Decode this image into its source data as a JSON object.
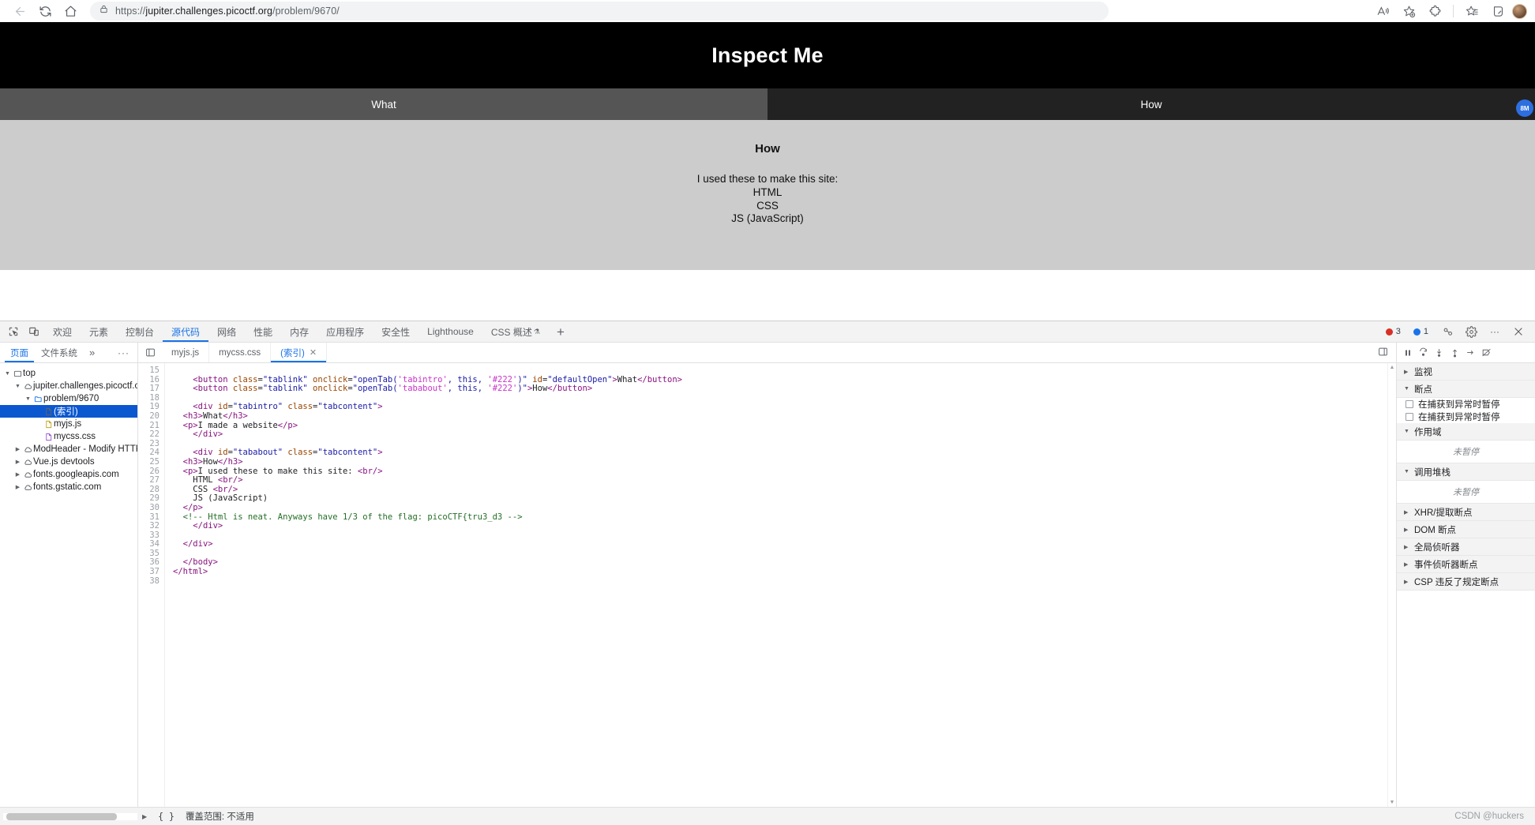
{
  "browser": {
    "url_scheme": "https://",
    "url_main": "jupiter.challenges.picoctf.org",
    "url_path": "/problem/9670/",
    "back_icon": "back-arrow-icon",
    "reload_icon": "reload-icon",
    "home_icon": "home-icon",
    "lock_icon": "lock-icon",
    "read_aloud_icon": "read-aloud-icon",
    "add_favorite_icon": "add-favorite-icon",
    "extensions_icon": "extensions-icon",
    "favorites_icon": "favorites-icon",
    "collections_icon": "collections-icon",
    "profile_icon": "profile-avatar"
  },
  "webpage": {
    "title": "Inspect Me",
    "tabs": [
      {
        "label": "What",
        "active": false
      },
      {
        "label": "How",
        "active": true
      }
    ],
    "content_heading": "How",
    "content_lines": [
      "I used these to make this site:",
      "HTML",
      "CSS",
      "JS (JavaScript)"
    ],
    "float_badge": "8M"
  },
  "devtools": {
    "inspect_icon": "inspect-element-icon",
    "device_icon": "device-toolbar-icon",
    "tabs": [
      {
        "label": "欢迎",
        "active": false
      },
      {
        "label": "元素",
        "active": false
      },
      {
        "label": "控制台",
        "active": false
      },
      {
        "label": "源代码",
        "active": true
      },
      {
        "label": "网络",
        "active": false
      },
      {
        "label": "性能",
        "active": false
      },
      {
        "label": "内存",
        "active": false
      },
      {
        "label": "应用程序",
        "active": false
      },
      {
        "label": "安全性",
        "active": false
      },
      {
        "label": "Lighthouse",
        "active": false
      },
      {
        "label": "CSS 概述",
        "active": false,
        "beta": "⚗"
      }
    ],
    "add_tab_label": "+",
    "error_count": "3",
    "info_count": "1",
    "cast_icon": "cast-icon",
    "settings_icon": "gear-icon",
    "more_icon": "more-options-icon",
    "close_icon": "close-icon",
    "error_color": "#d93025",
    "info_color": "#1a73e8",
    "accent_color": "#1a73e8"
  },
  "navigator": {
    "tabs": [
      {
        "label": "页面",
        "active": true
      },
      {
        "label": "文件系统",
        "active": false
      }
    ],
    "more_label": "»",
    "dots_label": "···",
    "tree": [
      {
        "label": "top",
        "depth": 0,
        "twisty": "▼",
        "icon": "frame-icon",
        "selected": false
      },
      {
        "label": "jupiter.challenges.picoctf.org",
        "depth": 1,
        "twisty": "▼",
        "icon": "cloud-icon",
        "selected": false
      },
      {
        "label": "problem/9670",
        "depth": 2,
        "twisty": "▼",
        "icon": "folder-icon",
        "selected": false
      },
      {
        "label": "(索引)",
        "depth": 3,
        "twisty": "",
        "icon": "document-icon",
        "selected": true
      },
      {
        "label": "myjs.js",
        "depth": 3,
        "twisty": "",
        "icon": "js-file-icon",
        "selected": false
      },
      {
        "label": "mycss.css",
        "depth": 3,
        "twisty": "",
        "icon": "css-file-icon",
        "selected": false
      },
      {
        "label": "ModHeader - Modify HTTP head",
        "depth": 1,
        "twisty": "▶",
        "icon": "cloud-icon",
        "selected": false
      },
      {
        "label": "Vue.js devtools",
        "depth": 1,
        "twisty": "▶",
        "icon": "cloud-icon",
        "selected": false
      },
      {
        "label": "fonts.googleapis.com",
        "depth": 1,
        "twisty": "▶",
        "icon": "cloud-icon",
        "selected": false
      },
      {
        "label": "fonts.gstatic.com",
        "depth": 1,
        "twisty": "▶",
        "icon": "cloud-icon",
        "selected": false
      }
    ]
  },
  "editor": {
    "panel_toggle_icon": "show-navigator-icon",
    "more_icon": "show-debugger-icon",
    "tabs": [
      {
        "label": "myjs.js",
        "active": false,
        "closable": false
      },
      {
        "label": "mycss.css",
        "active": false,
        "closable": false
      },
      {
        "label": "(索引)",
        "active": true,
        "closable": true
      }
    ],
    "close_glyph": "✕",
    "first_line_number": 15,
    "last_line_number": 38,
    "lines": [
      {
        "n": 15,
        "tokens": []
      },
      {
        "n": 16,
        "tokens": [
          {
            "t": "    ",
            "c": "tk-txt"
          },
          {
            "t": "<button",
            "c": "tk-tag"
          },
          {
            "t": " class",
            "c": "tk-attr"
          },
          {
            "t": "=",
            "c": "tk-txt"
          },
          {
            "t": "\"tablink\"",
            "c": "tk-val"
          },
          {
            "t": " onclick",
            "c": "tk-attr"
          },
          {
            "t": "=",
            "c": "tk-txt"
          },
          {
            "t": "\"openTab(",
            "c": "tk-val"
          },
          {
            "t": "'tabintro'",
            "c": "tk-kw"
          },
          {
            "t": ", ",
            "c": "tk-val"
          },
          {
            "t": "this",
            "c": "tk-fn"
          },
          {
            "t": ", ",
            "c": "tk-val"
          },
          {
            "t": "'#222'",
            "c": "tk-kw"
          },
          {
            "t": ")\"",
            "c": "tk-val"
          },
          {
            "t": " id",
            "c": "tk-attr"
          },
          {
            "t": "=",
            "c": "tk-txt"
          },
          {
            "t": "\"defaultOpen\"",
            "c": "tk-val"
          },
          {
            "t": ">",
            "c": "tk-tag"
          },
          {
            "t": "What",
            "c": "tk-txt"
          },
          {
            "t": "</button>",
            "c": "tk-tag"
          }
        ]
      },
      {
        "n": 17,
        "tokens": [
          {
            "t": "    ",
            "c": "tk-txt"
          },
          {
            "t": "<button",
            "c": "tk-tag"
          },
          {
            "t": " class",
            "c": "tk-attr"
          },
          {
            "t": "=",
            "c": "tk-txt"
          },
          {
            "t": "\"tablink\"",
            "c": "tk-val"
          },
          {
            "t": " onclick",
            "c": "tk-attr"
          },
          {
            "t": "=",
            "c": "tk-txt"
          },
          {
            "t": "\"openTab(",
            "c": "tk-val"
          },
          {
            "t": "'tababout'",
            "c": "tk-kw"
          },
          {
            "t": ", ",
            "c": "tk-val"
          },
          {
            "t": "this",
            "c": "tk-fn"
          },
          {
            "t": ", ",
            "c": "tk-val"
          },
          {
            "t": "'#222'",
            "c": "tk-kw"
          },
          {
            "t": ")\"",
            "c": "tk-val"
          },
          {
            "t": ">",
            "c": "tk-tag"
          },
          {
            "t": "How",
            "c": "tk-txt"
          },
          {
            "t": "</button>",
            "c": "tk-tag"
          }
        ]
      },
      {
        "n": 18,
        "tokens": []
      },
      {
        "n": 19,
        "tokens": [
          {
            "t": "    ",
            "c": "tk-txt"
          },
          {
            "t": "<div",
            "c": "tk-tag"
          },
          {
            "t": " id",
            "c": "tk-attr"
          },
          {
            "t": "=",
            "c": "tk-txt"
          },
          {
            "t": "\"tabintro\"",
            "c": "tk-val"
          },
          {
            "t": " class",
            "c": "tk-attr"
          },
          {
            "t": "=",
            "c": "tk-txt"
          },
          {
            "t": "\"tabcontent\"",
            "c": "tk-val"
          },
          {
            "t": ">",
            "c": "tk-tag"
          }
        ]
      },
      {
        "n": 20,
        "tokens": [
          {
            "t": "  ",
            "c": "tk-txt"
          },
          {
            "t": "<h3>",
            "c": "tk-tag"
          },
          {
            "t": "What",
            "c": "tk-txt"
          },
          {
            "t": "</h3>",
            "c": "tk-tag"
          }
        ]
      },
      {
        "n": 21,
        "tokens": [
          {
            "t": "  ",
            "c": "tk-txt"
          },
          {
            "t": "<p>",
            "c": "tk-tag"
          },
          {
            "t": "I made a website",
            "c": "tk-txt"
          },
          {
            "t": "</p>",
            "c": "tk-tag"
          }
        ]
      },
      {
        "n": 22,
        "tokens": [
          {
            "t": "    ",
            "c": "tk-txt"
          },
          {
            "t": "</div>",
            "c": "tk-tag"
          }
        ]
      },
      {
        "n": 23,
        "tokens": []
      },
      {
        "n": 24,
        "tokens": [
          {
            "t": "    ",
            "c": "tk-txt"
          },
          {
            "t": "<div",
            "c": "tk-tag"
          },
          {
            "t": " id",
            "c": "tk-attr"
          },
          {
            "t": "=",
            "c": "tk-txt"
          },
          {
            "t": "\"tababout\"",
            "c": "tk-val"
          },
          {
            "t": " class",
            "c": "tk-attr"
          },
          {
            "t": "=",
            "c": "tk-txt"
          },
          {
            "t": "\"tabcontent\"",
            "c": "tk-val"
          },
          {
            "t": ">",
            "c": "tk-tag"
          }
        ]
      },
      {
        "n": 25,
        "tokens": [
          {
            "t": "  ",
            "c": "tk-txt"
          },
          {
            "t": "<h3>",
            "c": "tk-tag"
          },
          {
            "t": "How",
            "c": "tk-txt"
          },
          {
            "t": "</h3>",
            "c": "tk-tag"
          }
        ]
      },
      {
        "n": 26,
        "tokens": [
          {
            "t": "  ",
            "c": "tk-txt"
          },
          {
            "t": "<p>",
            "c": "tk-tag"
          },
          {
            "t": "I used these to make this site: ",
            "c": "tk-txt"
          },
          {
            "t": "<br/>",
            "c": "tk-tag"
          }
        ]
      },
      {
        "n": 27,
        "tokens": [
          {
            "t": "    HTML ",
            "c": "tk-txt"
          },
          {
            "t": "<br/>",
            "c": "tk-tag"
          }
        ]
      },
      {
        "n": 28,
        "tokens": [
          {
            "t": "    CSS ",
            "c": "tk-txt"
          },
          {
            "t": "<br/>",
            "c": "tk-tag"
          }
        ]
      },
      {
        "n": 29,
        "tokens": [
          {
            "t": "    JS (JavaScript)",
            "c": "tk-txt"
          }
        ]
      },
      {
        "n": 30,
        "tokens": [
          {
            "t": "  ",
            "c": "tk-txt"
          },
          {
            "t": "</p>",
            "c": "tk-tag"
          }
        ]
      },
      {
        "n": 31,
        "tokens": [
          {
            "t": "  ",
            "c": "tk-txt"
          },
          {
            "t": "<!-- Html is neat. Anyways have 1/3 of the flag: picoCTF{tru3_d3 -->",
            "c": "tk-com"
          }
        ]
      },
      {
        "n": 32,
        "tokens": [
          {
            "t": "    ",
            "c": "tk-txt"
          },
          {
            "t": "</div>",
            "c": "tk-tag"
          }
        ]
      },
      {
        "n": 33,
        "tokens": []
      },
      {
        "n": 34,
        "tokens": [
          {
            "t": "  ",
            "c": "tk-txt"
          },
          {
            "t": "</div>",
            "c": "tk-tag"
          }
        ]
      },
      {
        "n": 35,
        "tokens": []
      },
      {
        "n": 36,
        "tokens": [
          {
            "t": "  ",
            "c": "tk-txt"
          },
          {
            "t": "</body>",
            "c": "tk-tag"
          }
        ]
      },
      {
        "n": 37,
        "tokens": [
          {
            "t": "</html>",
            "c": "tk-tag"
          }
        ]
      },
      {
        "n": 38,
        "tokens": []
      }
    ]
  },
  "debugger": {
    "toolbar_icons": [
      "pause-resume-icon",
      "step-over-icon",
      "step-into-icon",
      "step-out-icon",
      "step-icon",
      "deactivate-breakpoints-icon"
    ],
    "sections": [
      {
        "label": "监视",
        "caret": "▶",
        "expanded": false
      },
      {
        "label": "断点",
        "caret": "▼",
        "expanded": true
      },
      {
        "label": "作用域",
        "caret": "▼",
        "expanded": true
      },
      {
        "label": "调用堆栈",
        "caret": "▼",
        "expanded": true
      },
      {
        "label": "XHR/提取断点",
        "caret": "▶",
        "expanded": false
      },
      {
        "label": "DOM 断点",
        "caret": "▶",
        "expanded": false
      },
      {
        "label": "全局侦听器",
        "caret": "▶",
        "expanded": false
      },
      {
        "label": "事件侦听器断点",
        "caret": "▶",
        "expanded": false
      },
      {
        "label": "CSP 违反了规定断点",
        "caret": "▶",
        "expanded": false
      }
    ],
    "breakpoint_options": [
      {
        "label": "在捕获到异常时暂停",
        "checked": false
      },
      {
        "label": "在捕获到异常时暂停",
        "checked": false
      }
    ],
    "not_paused": "未暂停"
  },
  "footer": {
    "braces": "{ }",
    "coverage_text": "覆盖范围: 不适用",
    "watermark": "CSDN @huckers"
  }
}
